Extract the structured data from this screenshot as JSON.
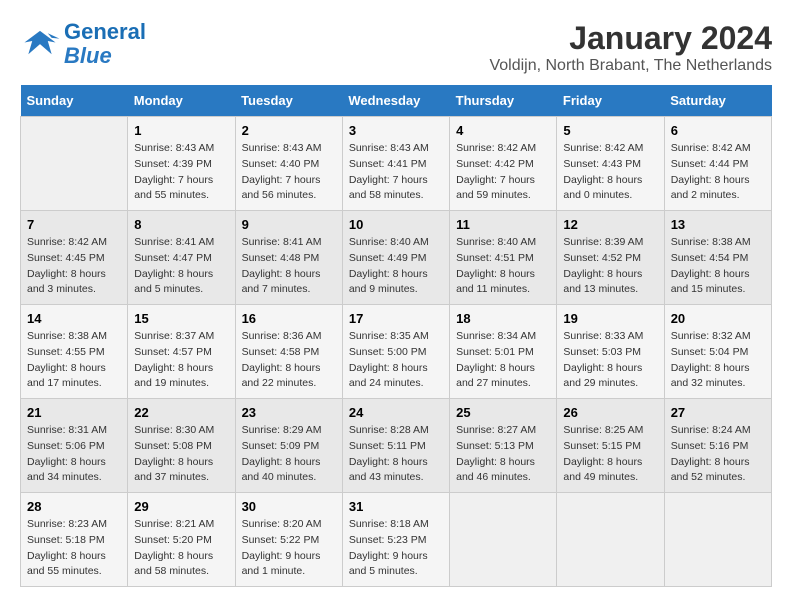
{
  "header": {
    "logo_line1": "General",
    "logo_line2": "Blue",
    "main_title": "January 2024",
    "subtitle": "Voldijn, North Brabant, The Netherlands"
  },
  "days_of_week": [
    "Sunday",
    "Monday",
    "Tuesday",
    "Wednesday",
    "Thursday",
    "Friday",
    "Saturday"
  ],
  "weeks": [
    [
      {
        "day": "",
        "info": ""
      },
      {
        "day": "1",
        "info": "Sunrise: 8:43 AM\nSunset: 4:39 PM\nDaylight: 7 hours\nand 55 minutes."
      },
      {
        "day": "2",
        "info": "Sunrise: 8:43 AM\nSunset: 4:40 PM\nDaylight: 7 hours\nand 56 minutes."
      },
      {
        "day": "3",
        "info": "Sunrise: 8:43 AM\nSunset: 4:41 PM\nDaylight: 7 hours\nand 58 minutes."
      },
      {
        "day": "4",
        "info": "Sunrise: 8:42 AM\nSunset: 4:42 PM\nDaylight: 7 hours\nand 59 minutes."
      },
      {
        "day": "5",
        "info": "Sunrise: 8:42 AM\nSunset: 4:43 PM\nDaylight: 8 hours\nand 0 minutes."
      },
      {
        "day": "6",
        "info": "Sunrise: 8:42 AM\nSunset: 4:44 PM\nDaylight: 8 hours\nand 2 minutes."
      }
    ],
    [
      {
        "day": "7",
        "info": "Sunrise: 8:42 AM\nSunset: 4:45 PM\nDaylight: 8 hours\nand 3 minutes."
      },
      {
        "day": "8",
        "info": "Sunrise: 8:41 AM\nSunset: 4:47 PM\nDaylight: 8 hours\nand 5 minutes."
      },
      {
        "day": "9",
        "info": "Sunrise: 8:41 AM\nSunset: 4:48 PM\nDaylight: 8 hours\nand 7 minutes."
      },
      {
        "day": "10",
        "info": "Sunrise: 8:40 AM\nSunset: 4:49 PM\nDaylight: 8 hours\nand 9 minutes."
      },
      {
        "day": "11",
        "info": "Sunrise: 8:40 AM\nSunset: 4:51 PM\nDaylight: 8 hours\nand 11 minutes."
      },
      {
        "day": "12",
        "info": "Sunrise: 8:39 AM\nSunset: 4:52 PM\nDaylight: 8 hours\nand 13 minutes."
      },
      {
        "day": "13",
        "info": "Sunrise: 8:38 AM\nSunset: 4:54 PM\nDaylight: 8 hours\nand 15 minutes."
      }
    ],
    [
      {
        "day": "14",
        "info": "Sunrise: 8:38 AM\nSunset: 4:55 PM\nDaylight: 8 hours\nand 17 minutes."
      },
      {
        "day": "15",
        "info": "Sunrise: 8:37 AM\nSunset: 4:57 PM\nDaylight: 8 hours\nand 19 minutes."
      },
      {
        "day": "16",
        "info": "Sunrise: 8:36 AM\nSunset: 4:58 PM\nDaylight: 8 hours\nand 22 minutes."
      },
      {
        "day": "17",
        "info": "Sunrise: 8:35 AM\nSunset: 5:00 PM\nDaylight: 8 hours\nand 24 minutes."
      },
      {
        "day": "18",
        "info": "Sunrise: 8:34 AM\nSunset: 5:01 PM\nDaylight: 8 hours\nand 27 minutes."
      },
      {
        "day": "19",
        "info": "Sunrise: 8:33 AM\nSunset: 5:03 PM\nDaylight: 8 hours\nand 29 minutes."
      },
      {
        "day": "20",
        "info": "Sunrise: 8:32 AM\nSunset: 5:04 PM\nDaylight: 8 hours\nand 32 minutes."
      }
    ],
    [
      {
        "day": "21",
        "info": "Sunrise: 8:31 AM\nSunset: 5:06 PM\nDaylight: 8 hours\nand 34 minutes."
      },
      {
        "day": "22",
        "info": "Sunrise: 8:30 AM\nSunset: 5:08 PM\nDaylight: 8 hours\nand 37 minutes."
      },
      {
        "day": "23",
        "info": "Sunrise: 8:29 AM\nSunset: 5:09 PM\nDaylight: 8 hours\nand 40 minutes."
      },
      {
        "day": "24",
        "info": "Sunrise: 8:28 AM\nSunset: 5:11 PM\nDaylight: 8 hours\nand 43 minutes."
      },
      {
        "day": "25",
        "info": "Sunrise: 8:27 AM\nSunset: 5:13 PM\nDaylight: 8 hours\nand 46 minutes."
      },
      {
        "day": "26",
        "info": "Sunrise: 8:25 AM\nSunset: 5:15 PM\nDaylight: 8 hours\nand 49 minutes."
      },
      {
        "day": "27",
        "info": "Sunrise: 8:24 AM\nSunset: 5:16 PM\nDaylight: 8 hours\nand 52 minutes."
      }
    ],
    [
      {
        "day": "28",
        "info": "Sunrise: 8:23 AM\nSunset: 5:18 PM\nDaylight: 8 hours\nand 55 minutes."
      },
      {
        "day": "29",
        "info": "Sunrise: 8:21 AM\nSunset: 5:20 PM\nDaylight: 8 hours\nand 58 minutes."
      },
      {
        "day": "30",
        "info": "Sunrise: 8:20 AM\nSunset: 5:22 PM\nDaylight: 9 hours\nand 1 minute."
      },
      {
        "day": "31",
        "info": "Sunrise: 8:18 AM\nSunset: 5:23 PM\nDaylight: 9 hours\nand 5 minutes."
      },
      {
        "day": "",
        "info": ""
      },
      {
        "day": "",
        "info": ""
      },
      {
        "day": "",
        "info": ""
      }
    ]
  ]
}
